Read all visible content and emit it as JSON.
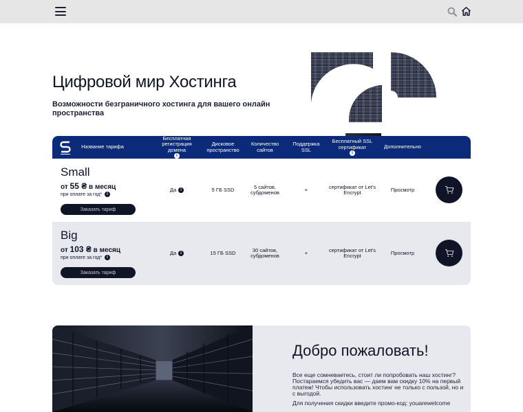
{
  "topbar": {
    "menu_icon": "hamburger-menu-icon",
    "search_icon": "search-icon",
    "home_icon": "home-icon"
  },
  "hero": {
    "title": "Цифровой мир Хостинга",
    "subtitle": "Возможности безграничного хостинга для вашего онлайн пространства"
  },
  "plans": {
    "logo_icon": "brand-s-logo-icon",
    "headers": {
      "name": "Название тарифа",
      "domain": "Бесплатная регистрация домена",
      "disk": "Дисковое пространство",
      "sites": "Количество сайтов",
      "support": "Поддержка SSL",
      "ssl": "Бесплатный SSL сертификат",
      "extra": "Дополнительно"
    },
    "info_glyph": "i",
    "items": [
      {
        "name": "Small",
        "price_prefix": "от ",
        "price_value": "55 ₴",
        "price_suffix": " в месяц",
        "note": "при оплате за год*",
        "order_label": "Заказать тариф",
        "domain": "Да",
        "disk": "5 ГБ SSD",
        "sites": "5 сайтов, субдоменов",
        "support": "+",
        "ssl": "сертификат от Let's Encrypt",
        "extra": "Просмотр"
      },
      {
        "name": "Big",
        "price_prefix": "от ",
        "price_value": "103 ₴",
        "price_suffix": " в месяц",
        "note": "при оплате за год*",
        "order_label": "Заказать тариф",
        "domain": "Да",
        "disk": "15 ГБ SSD",
        "sites": "30 сайтов, субдоменов",
        "support": "+",
        "ssl": "сертификат от Let's Encrypt",
        "extra": "Просмотр"
      }
    ]
  },
  "welcome": {
    "title": "Добро пожаловать!",
    "text": "Все еще сомневаетесь, стоит ли попробовать наш хостинг? Постараемся убедить вас — даем вам скидку 10% на первый платеж! Чтобы использовать хостинг не только с пользой, но и с выгодой.",
    "promo": "Для получения скидки введите промо-код: youarewelcome"
  },
  "colors": {
    "navy": "#0b2a7a",
    "dark": "#0f1426",
    "light_row": "#e8e9ee",
    "topbar": "#e6e6e6"
  }
}
